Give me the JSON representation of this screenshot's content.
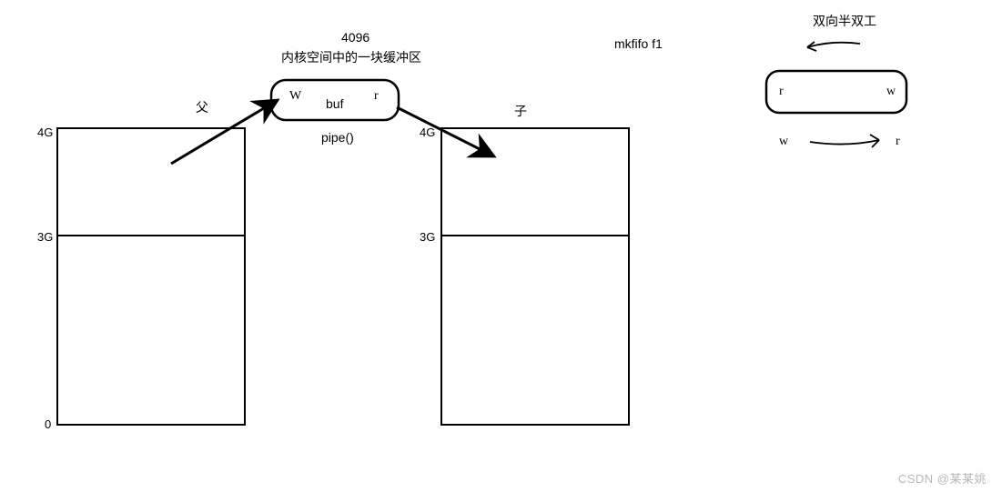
{
  "buffer": {
    "size": "4096",
    "desc": "内核空间中的一块缓冲区",
    "write_sym": "W",
    "label": "buf",
    "read_sym": "r",
    "func": "pipe()"
  },
  "mkfifo": "mkfifo   f1",
  "left": {
    "title": "父",
    "mark_top": "4G",
    "mark_mid": "3G",
    "mark_bot": "0"
  },
  "right": {
    "title": "子",
    "mark_top": "4G",
    "mark_mid": "3G"
  },
  "duplex": {
    "title": "双向半双工",
    "r": "r",
    "w": "w",
    "w2": "w",
    "r2": "r"
  },
  "watermark": "CSDN @某某姚"
}
